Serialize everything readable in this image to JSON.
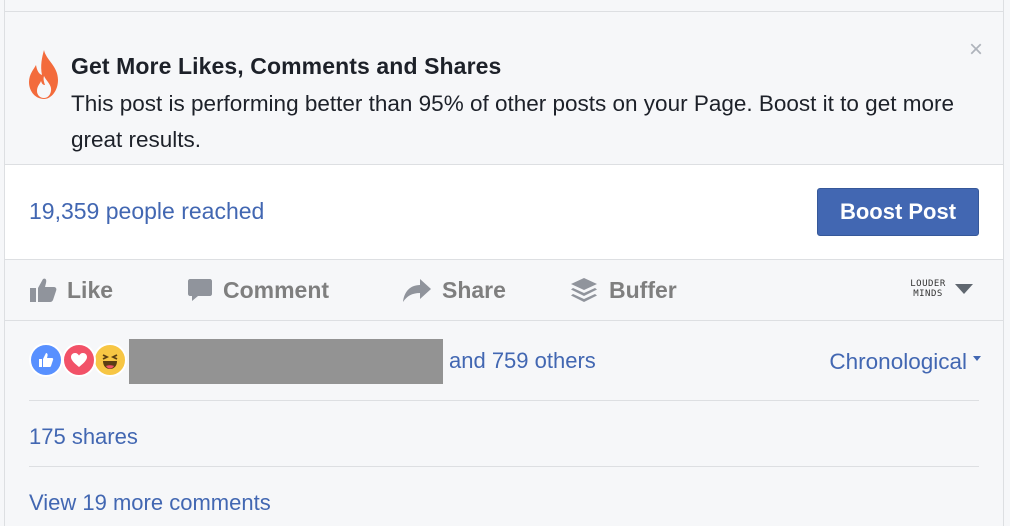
{
  "banner": {
    "title": "Get More Likes, Comments and Shares",
    "body": "This post is performing better than 95% of other posts on your Page. Boost it to get more great results.",
    "close_glyph": "×",
    "icon": "flame-icon",
    "icon_color": "#f36b3c"
  },
  "reach": {
    "text": "19,359 people reached",
    "boost_label": "Boost Post",
    "button_color": "#4267b2"
  },
  "actions": {
    "like": "Like",
    "comment": "Comment",
    "share": "Share",
    "buffer": "Buffer",
    "profile_logo_line1": "LOUDER",
    "profile_logo_line2": "MINDS"
  },
  "reactions": {
    "others": "and 759 others",
    "sort": "Chronological",
    "icons": [
      "like-reaction-icon",
      "love-reaction-icon",
      "haha-reaction-icon"
    ]
  },
  "shares": "175 shares",
  "more_comments": "View 19 more comments",
  "colors": {
    "link": "#4267b2",
    "text": "#1d2129",
    "muted": "#7f7f7f",
    "border": "#dddfe2",
    "bg": "#f6f7f9"
  }
}
